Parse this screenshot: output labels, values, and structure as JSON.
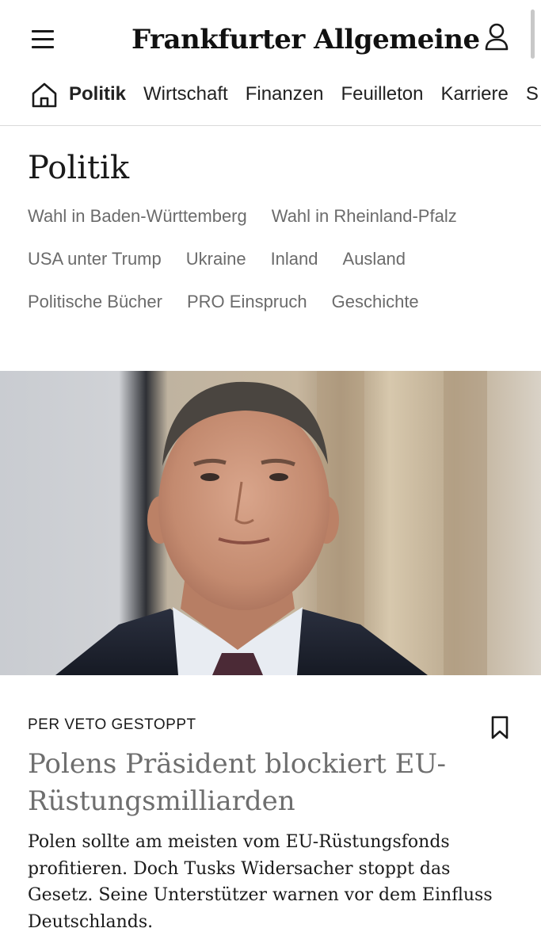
{
  "header": {
    "logo_text": "Frankfurter Allgemeine",
    "menu_icon": "hamburger-menu-icon",
    "user_icon": "user-icon"
  },
  "nav": {
    "home_icon": "home-icon",
    "items": [
      {
        "label": "Politik",
        "active": true
      },
      {
        "label": "Wirtschaft"
      },
      {
        "label": "Finanzen"
      },
      {
        "label": "Feuilleton"
      },
      {
        "label": "Karriere"
      },
      {
        "label": "S"
      }
    ]
  },
  "section": {
    "title": "Politik",
    "links": [
      [
        "Wahl in Baden-Württemberg",
        "Wahl in Rheinland-Pfalz"
      ],
      [
        "USA unter Trump",
        "Ukraine",
        "Inland",
        "Ausland"
      ],
      [
        "Politische Bücher",
        "PRO Einspruch",
        "Geschichte"
      ]
    ]
  },
  "article": {
    "kicker": "PER VETO GESTOPPT",
    "headline": "Polens Präsident blockiert EU-Rüstungsmilliarden",
    "teaser": "Polen sollte am meisten vom EU-Rüstungsfonds profitieren. Doch Tusks Widersacher stoppt das Gesetz. Seine Unterstützer warnen vor dem Einfluss Deutschlands.",
    "bookmark_icon": "bookmark-icon"
  }
}
